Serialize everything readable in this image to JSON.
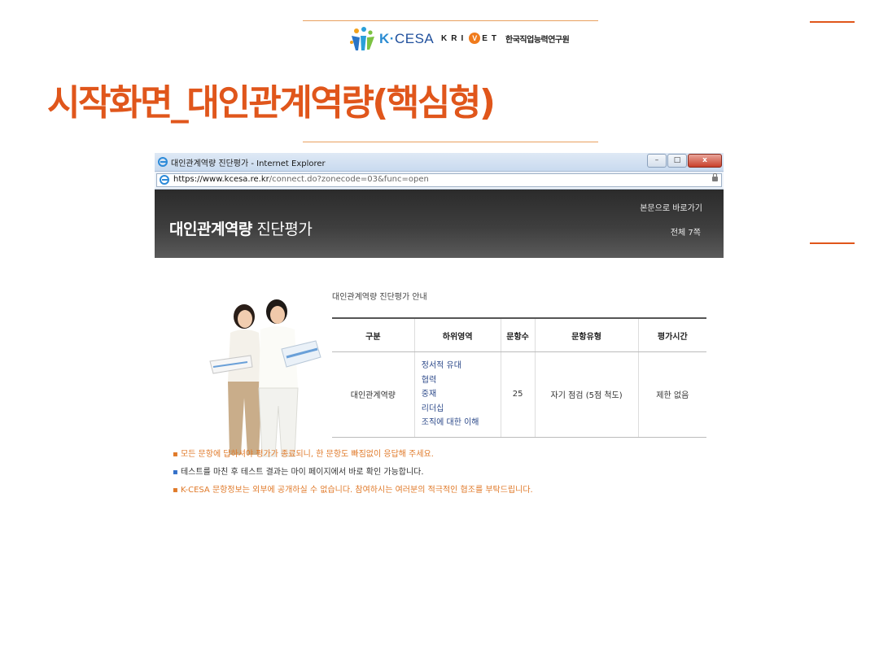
{
  "slide": {
    "title": "시작화면_대인관계역량(핵심형)",
    "logos": {
      "kcesa_text_k": "K·",
      "kcesa_text_rest": "CESA",
      "krivet_letters": "KRI",
      "krivet_v": "V",
      "krivet_letters_end": "ET",
      "krivet_korean": "한국직업능력연구원"
    }
  },
  "browser": {
    "window_title": "대인관계역량 진단평가 - Internet Explorer",
    "url_prefix": "https://www.",
    "url_domain": "kcesa.re.kr",
    "url_path": "/connect.do?zonecode=03&func=open",
    "buttons": {
      "minimize": "–",
      "maximize": "□",
      "close": "x"
    }
  },
  "app": {
    "title_bold": "대인관계역량",
    "title_rest": " 진단평가",
    "skip_link": "본문으로 바로가기",
    "page_count": "전체 7쪽"
  },
  "guide": {
    "title": "대인관계역량 진단평가 안내",
    "table": {
      "headers": [
        "구분",
        "하위영역",
        "문항수",
        "문항유형",
        "평가시간"
      ],
      "row": {
        "category": "대인관계역량",
        "subareas": [
          "정서적 유대",
          "협력",
          "중재",
          "리더십",
          "조직에 대한 이해"
        ],
        "count": "25",
        "type": "자기 점검 (5점 척도)",
        "time": "제한 없음"
      }
    },
    "notes": [
      "모든 문항에 답하셔야 평가가 종료되니, 한 문항도 빠짐없이 응답해 주세요.",
      "테스트를 마친 후 테스트 결과는 마이 페이지에서 바로 확인 가능합니다.",
      "K-CESA 문항정보는 외부에 공개하실 수 없습니다. 참여하시는 여러분의 적극적인 협조를 부탁드립니다."
    ]
  },
  "colors": {
    "accent": "#e0561b",
    "header_dark": "#333333",
    "link_blue": "#2d4a8a"
  }
}
